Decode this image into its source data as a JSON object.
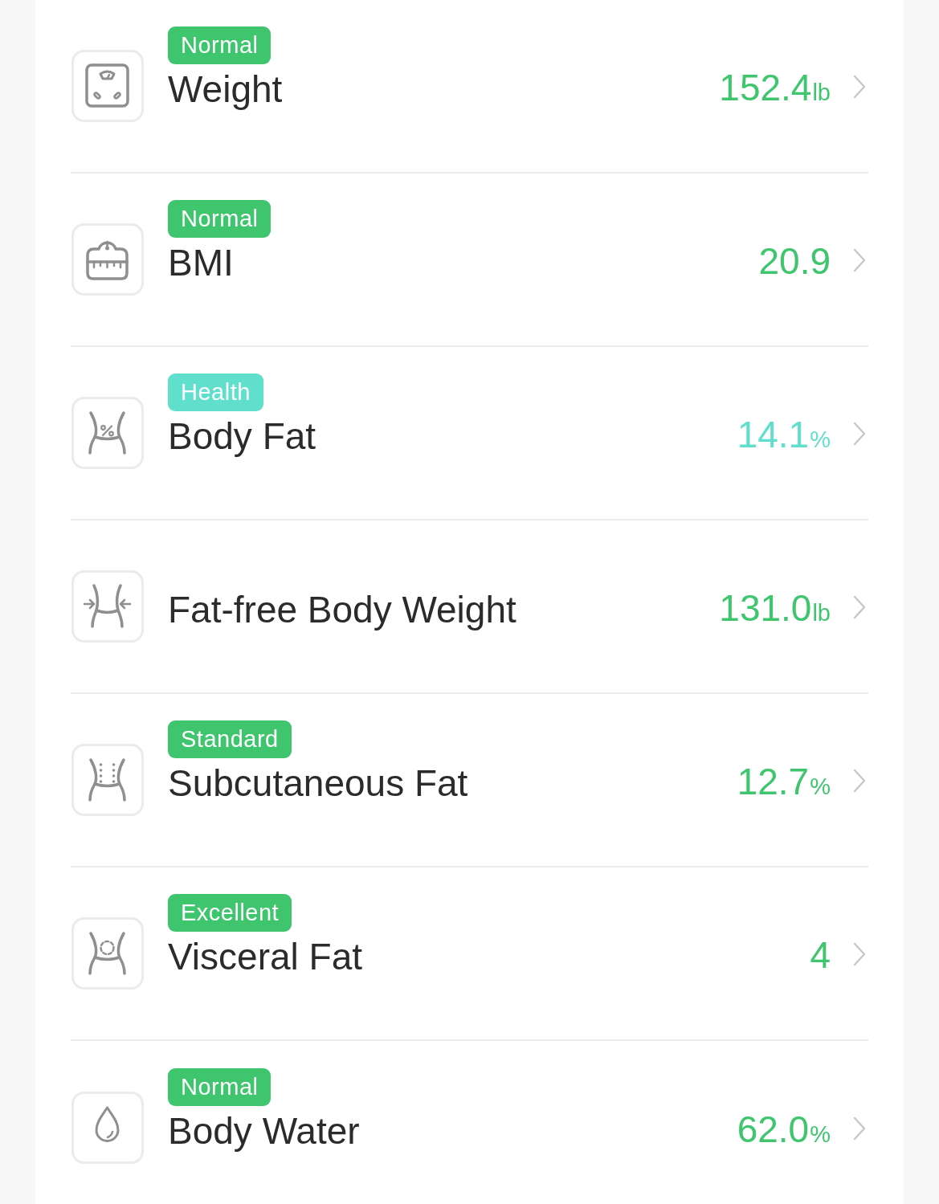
{
  "metrics": [
    {
      "kind": "scale",
      "badge": "Normal",
      "name": "Weight",
      "value": "152.4",
      "unit": "lb",
      "color": "#3fc56e"
    },
    {
      "kind": "dial",
      "badge": "Normal",
      "name": "BMI",
      "value": "20.9",
      "color": "#3fc56e"
    },
    {
      "kind": "percent",
      "badge": "Health",
      "name": "Body Fat",
      "value": "14.1",
      "unit": "%",
      "color": "#5fdfcc"
    },
    {
      "kind": "arrows",
      "name": "Fat-free Body Weight",
      "value": "131.0",
      "unit": "lb",
      "color": "#3fc56e"
    },
    {
      "kind": "dots",
      "badge": "Standard",
      "name": "Subcutaneous Fat",
      "value": "12.7",
      "unit": "%",
      "color": "#3fc56e"
    },
    {
      "kind": "ring",
      "badge": "Excellent",
      "name": "Visceral Fat",
      "value": "4",
      "color": "#3fc56e"
    },
    {
      "kind": "drop",
      "badge": "Normal",
      "name": "Body Water",
      "value": "62.0",
      "unit": "%",
      "color": "#3fc56e"
    }
  ]
}
